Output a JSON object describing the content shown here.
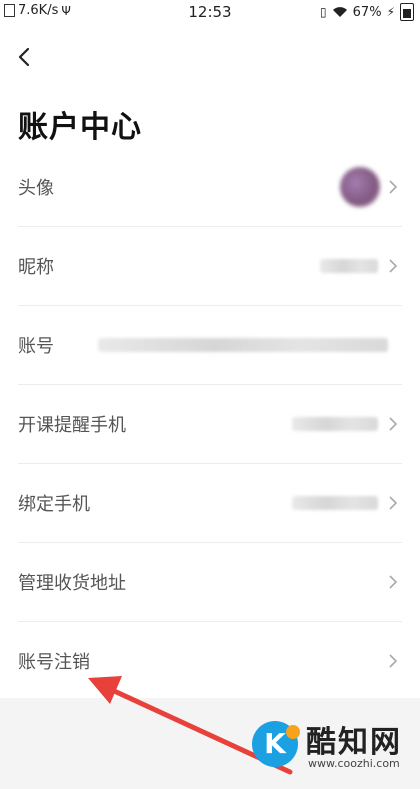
{
  "status_bar": {
    "speed": "7.6K/s",
    "time": "12:53",
    "battery_percent": "67%"
  },
  "header": {
    "title": "账户中心"
  },
  "rows": [
    {
      "label": "头像",
      "value_type": "avatar"
    },
    {
      "label": "昵称",
      "value_type": "blurred"
    },
    {
      "label": "账号",
      "value_type": "blurred"
    },
    {
      "label": "开课提醒手机",
      "value_type": "blurred"
    },
    {
      "label": "绑定手机",
      "value_type": "blurred"
    },
    {
      "label": "管理收货地址",
      "value_type": "none"
    },
    {
      "label": "账号注销",
      "value_type": "none"
    }
  ],
  "annotation": {
    "arrow_color": "#e8403a"
  },
  "watermark": {
    "logo_letter": "K",
    "name": "酷知网",
    "url": "www.coozhi.com"
  }
}
